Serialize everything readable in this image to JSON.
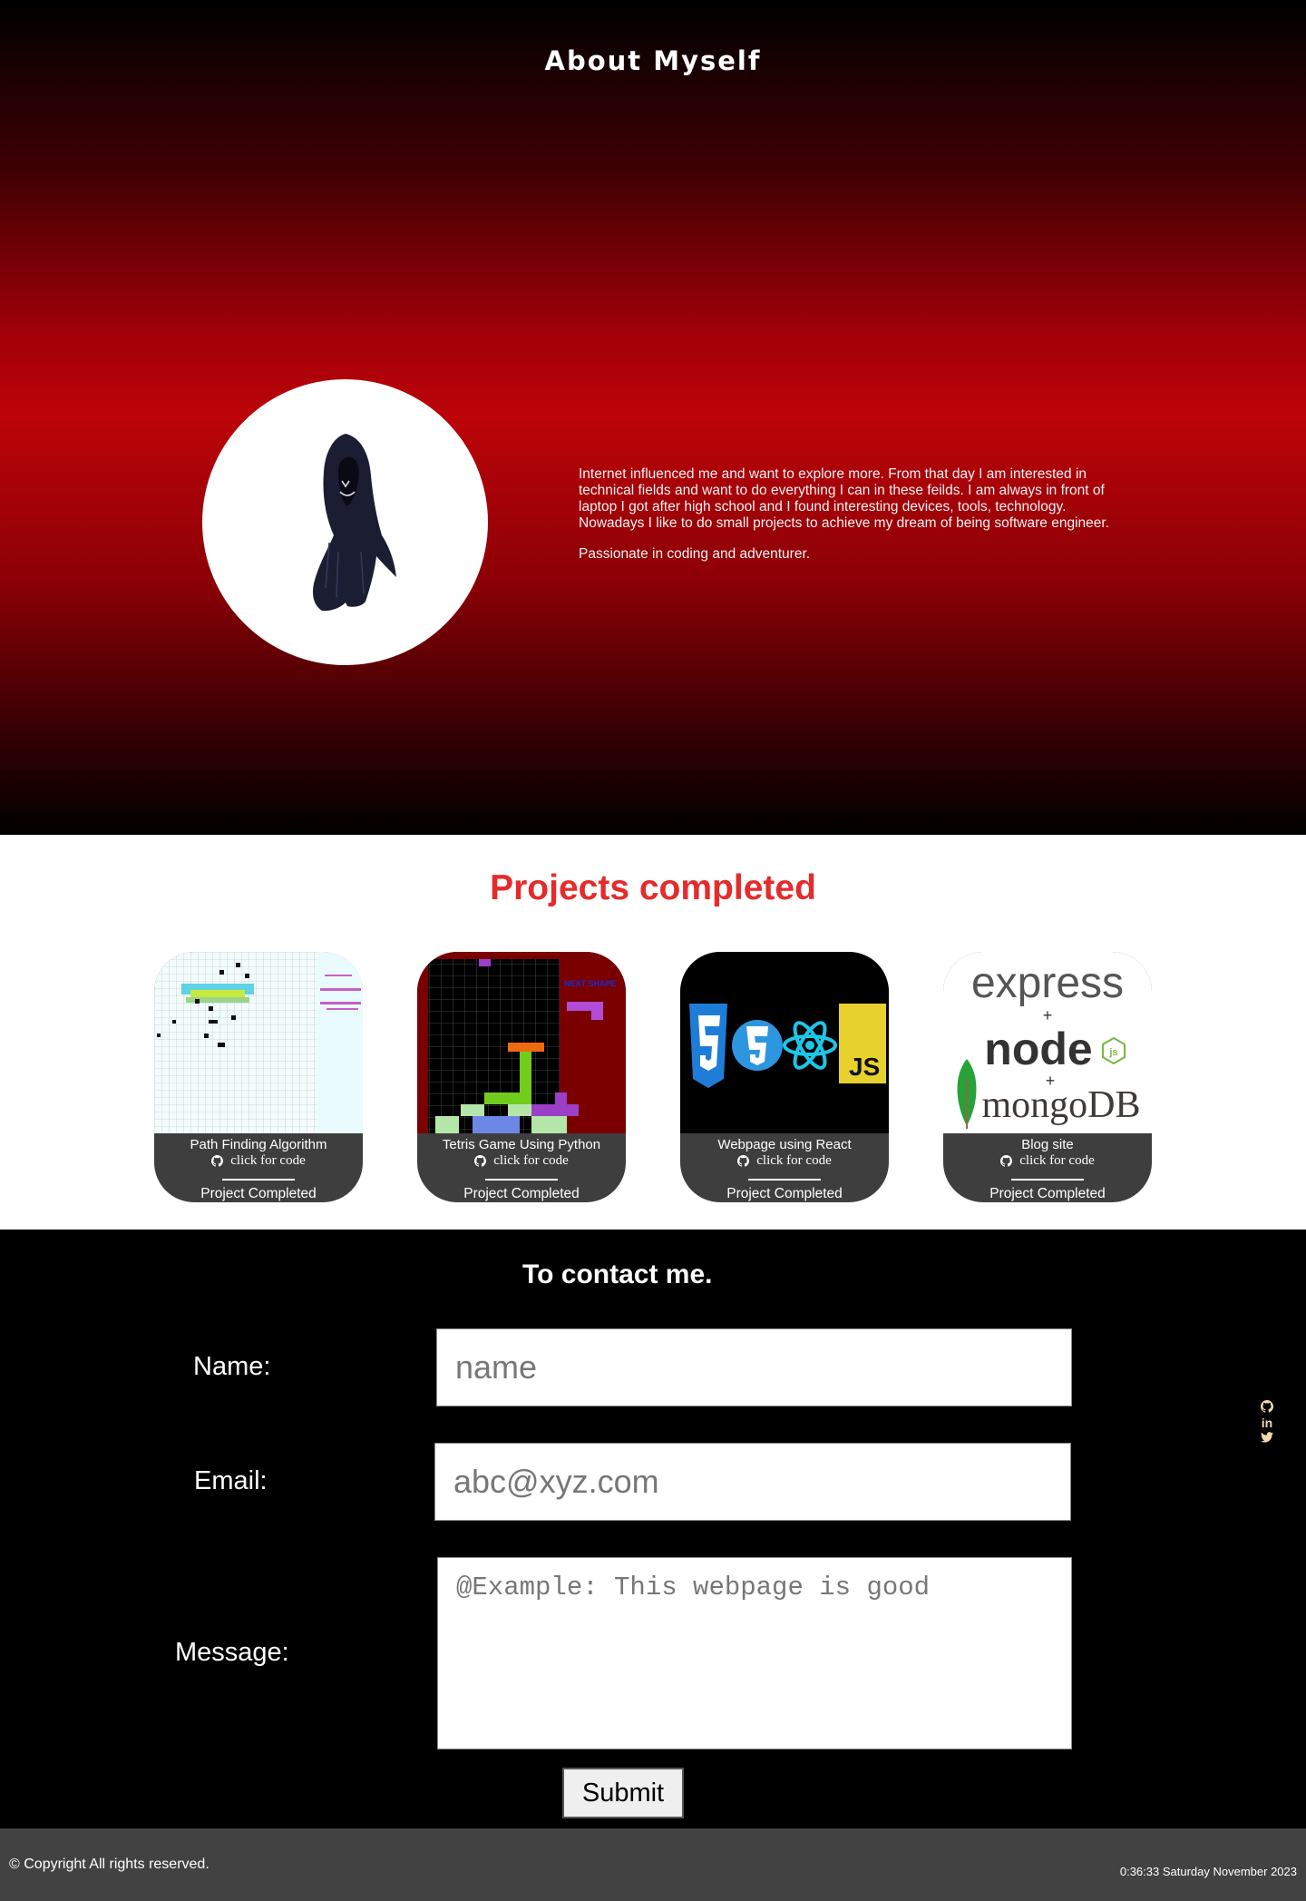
{
  "about": {
    "title": "About Myself",
    "paragraphs": [
      "Internet influenced me and want to explore more. From that day I am interested in technical fields and want to do everything I can in these feilds. I am always in front of laptop I got after high school and I found interesting devices, tools, technology. Nowadays I like to do small projects to achieve my dream of being software engineer.",
      "Passionate in coding and adventurer."
    ]
  },
  "projects": {
    "title": "Projects completed",
    "items": [
      {
        "name": "Path Finding Algorithm",
        "link_label": "click for code",
        "status": "Project Completed"
      },
      {
        "name": "Tetris Game Using Python",
        "link_label": "click for code",
        "status": "Project Completed",
        "thumb_text": "NEXT SHAPE"
      },
      {
        "name": "Webpage using React",
        "link_label": "click for code",
        "status": "Project Completed",
        "thumb_text": "JS"
      },
      {
        "name": "Blog site",
        "link_label": "click for code",
        "status": "Project Completed",
        "thumb_text": [
          "express",
          "+",
          "node",
          "js",
          "+",
          "mongoDB"
        ]
      }
    ]
  },
  "contact": {
    "title": "To contact me.",
    "name_label": "Name:",
    "name_placeholder": "name",
    "email_label": "Email:",
    "email_placeholder": "abc@xyz.com",
    "message_label": "Message:",
    "message_placeholder": "@Example: This webpage is good",
    "submit_label": "Submit"
  },
  "social": {
    "icons": [
      "github-icon",
      "linkedin-icon",
      "twitter-icon"
    ],
    "linkedin_glyph": "in"
  },
  "footer": {
    "copyright": "© Copyright All rights reserved.",
    "clock": "0:36:33 Saturday November 2023"
  },
  "colors": {
    "accent_red": "#e52b2b",
    "hero_red": "#bc0409",
    "card_bg": "#3e3e3e",
    "footer_bg": "#424242",
    "social_icon": "#f3d9b1"
  }
}
